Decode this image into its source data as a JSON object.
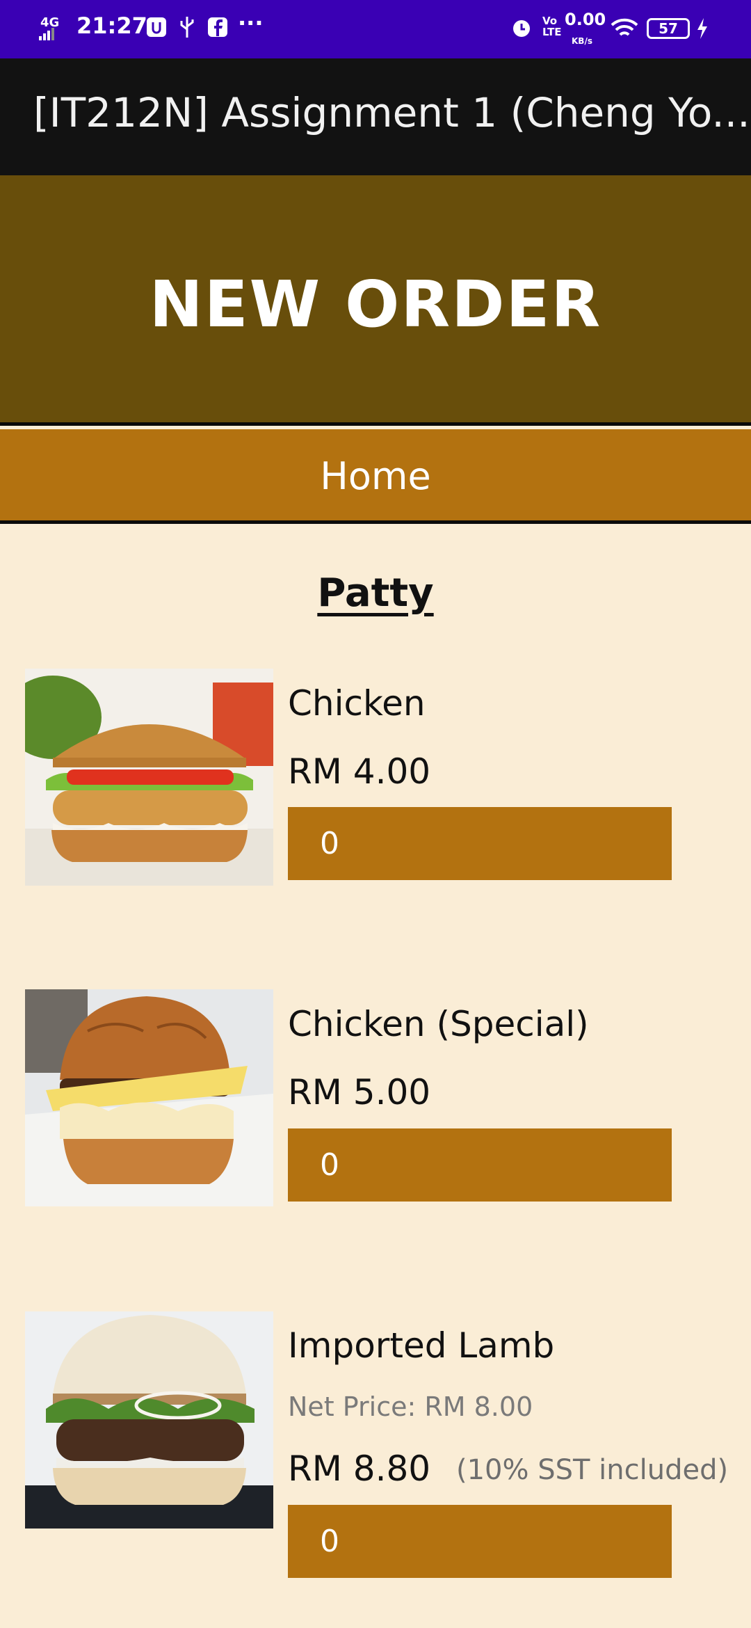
{
  "status_bar": {
    "network": "4G",
    "time": "21:27",
    "data_rate": "0.00",
    "data_rate_unit": "KB/s",
    "volte": "Vo LTE",
    "battery": "57"
  },
  "app_bar": {
    "title": "[IT212N] Assignment 1 (Cheng Yo..."
  },
  "header": {
    "title": "NEW ORDER"
  },
  "nav": {
    "home_label": "Home"
  },
  "section": {
    "title": "Patty"
  },
  "items": [
    {
      "name": "Chicken",
      "price": "RM 4.00",
      "quantity": "0"
    },
    {
      "name": "Chicken (Special)",
      "price": "RM 5.00",
      "quantity": "0"
    },
    {
      "name": "Imported Lamb",
      "net_price": "Net Price: RM 8.00",
      "price": "RM 8.80",
      "sst_note": "(10% SST included)",
      "quantity": "0"
    }
  ],
  "colors": {
    "status_bar": "#3a00b4",
    "app_bar": "#121212",
    "header": "#684e0b",
    "accent": "#b37210",
    "background": "#faedd6"
  }
}
